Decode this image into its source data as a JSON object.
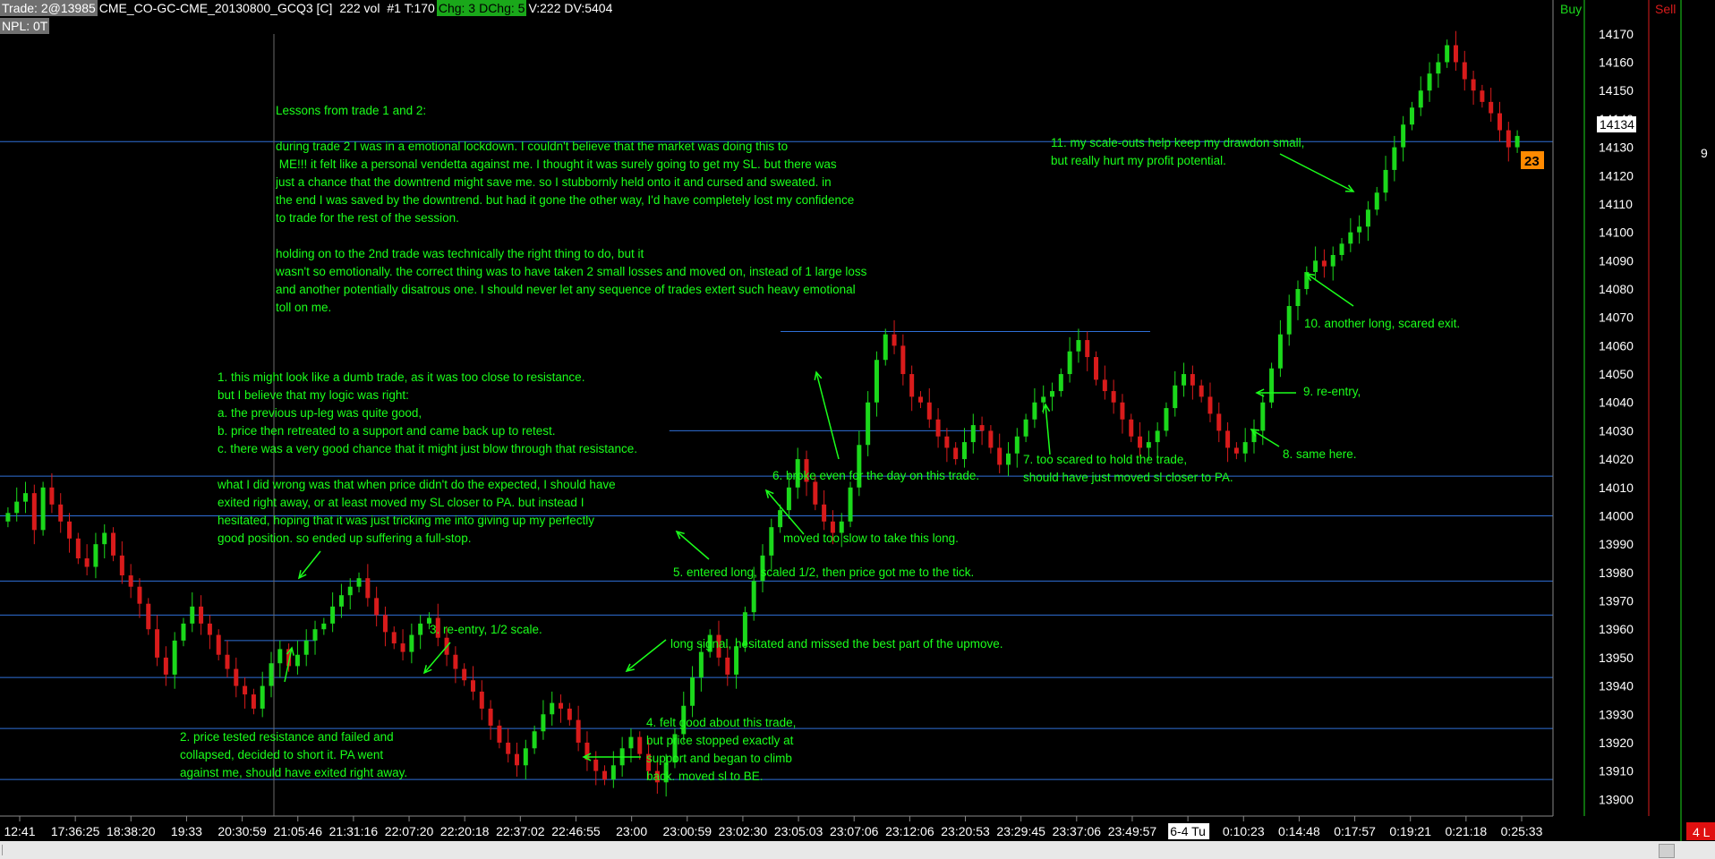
{
  "header": {
    "title": "Trade: 2@13985",
    "instrument": "CME_CO-GC-CME_20130800_GCQ3 [C]",
    "vol": "222 vol",
    "trade_no": "#1 T:170",
    "chg": "Chg: 3",
    "dchg": "DChg: 5",
    "volume": "V:222 DV:5404",
    "npl": "NPL: 0T"
  },
  "colors": {
    "background": "#000000",
    "up_candle": "#1bd81b",
    "down_candle": "#d81b1b",
    "level_line": "#2f6fd8",
    "annotation_text": "#1bff1b",
    "price_label": "#ffffff",
    "last_price_bg": "#ffffff",
    "tag_bg": "#ff8a00"
  },
  "dom": {
    "buy_label": "Buy",
    "sell_label": "Sell",
    "side_count": "9",
    "corner": "4 L"
  },
  "price_axis": {
    "labels": [
      "14170",
      "14160",
      "14150",
      "14140",
      "14130",
      "14120",
      "14110",
      "14100",
      "14090",
      "14080",
      "14070",
      "14060",
      "14050",
      "14040",
      "14030",
      "14020",
      "14010",
      "14000",
      "13990",
      "13980",
      "13970",
      "13960",
      "13950",
      "13940",
      "13930",
      "13920",
      "13910",
      "13900"
    ],
    "last_price": "14134",
    "tag": "23"
  },
  "time_axis": {
    "labels": [
      "12:41",
      "17:36:25",
      "18:38:20",
      "19:33",
      "20:30:59",
      "21:05:46",
      "21:31:16",
      "22:07:20",
      "22:20:18",
      "22:37:02",
      "22:46:55",
      "23:00",
      "23:00:59",
      "23:02:30",
      "23:05:03",
      "23:07:06",
      "23:12:06",
      "23:20:53",
      "23:29:45",
      "23:37:06",
      "23:49:57",
      "6-4 Tu",
      "0:10:23",
      "0:14:48",
      "0:17:57",
      "0:19:21",
      "0:21:18",
      "0:25:33"
    ]
  },
  "chart_data": {
    "type": "candlestick",
    "ylim": [
      13896,
      14175
    ],
    "levels": [
      14132,
      14014,
      14000,
      13977,
      13965,
      13943,
      13925,
      13907
    ],
    "segment_levels": [
      {
        "price": 14065,
        "from": "23:05:03",
        "to": "23:49:57"
      },
      {
        "price": 14030,
        "from": "23:00:59",
        "to": "23:20:53"
      },
      {
        "price": 13956,
        "from": "20:30:59",
        "to": "21:05:46"
      }
    ],
    "closes": [
      14001,
      14005,
      14008,
      13995,
      14010,
      14004,
      13998,
      13992,
      13985,
      13982,
      13990,
      13994,
      13986,
      13979,
      13975,
      13969,
      13960,
      13950,
      13944,
      13956,
      13962,
      13968,
      13962,
      13958,
      13951,
      13946,
      13940,
      13937,
      13932,
      13940,
      13948,
      13953,
      13947,
      13951,
      13956,
      13960,
      13962,
      13968,
      13972,
      13975,
      13978,
      13971,
      13965,
      13959,
      13955,
      13952,
      13958,
      13962,
      13964,
      13957,
      13951,
      13946,
      13942,
      13938,
      13932,
      13926,
      13920,
      13916,
      13912,
      13918,
      13924,
      13930,
      13934,
      13932,
      13928,
      13920,
      13914,
      13910,
      13907,
      13912,
      13918,
      13922,
      13916,
      13910,
      13906,
      13913,
      13923,
      13933,
      13943,
      13952,
      13958,
      13950,
      13944,
      13954,
      13966,
      13977,
      13986,
      13996,
      14002,
      14010,
      14020,
      14012,
      14004,
      13998,
      13994,
      13998,
      14010,
      14025,
      14040,
      14055,
      14064,
      14060,
      14050,
      14042,
      14040,
      14034,
      14028,
      14024,
      14020,
      14026,
      14032,
      14030,
      14024,
      14018,
      14022,
      14028,
      14034,
      14040,
      14042,
      14044,
      14050,
      14058,
      14062,
      14056,
      14048,
      14044,
      14040,
      14034,
      14028,
      14024,
      14026,
      14030,
      14038,
      14046,
      14050,
      14046,
      14042,
      14036,
      14030,
      14024,
      14022,
      14026,
      14030,
      14040,
      14052,
      14064,
      14074,
      14080,
      14086,
      14090,
      14088,
      14092,
      14096,
      14100,
      14102,
      14108,
      14114,
      14122,
      14130,
      14138,
      14144,
      14150,
      14156,
      14160,
      14166,
      14160,
      14154,
      14150,
      14146,
      14142,
      14136,
      14130,
      14134
    ]
  },
  "annotations": {
    "lessons": "Lessons from trade 1 and 2:\n\nduring trade 2 I was in a emotional lockdown. I couldn't believe that the market was doing this to\n ME!!! it felt like a personal vendetta against me. I thought it was surely going to get my SL. but there was\njust a chance that the downtrend might save me. so I stubbornly held onto it and cursed and sweated. in\nthe end I was saved by the downtrend. but had it gone the other way, I'd have completely lost my confidence\nto trade for the rest of the session.\n\nholding on to the 2nd trade was technically the right thing to do, but it\nwasn't so emotionally. the correct thing was to have taken 2 small losses and moved on, instead of 1 large loss\nand another potentially disatrous one. I should never let any sequence of trades extert such heavy emotional\ntoll on me.",
    "note1": "1. this might look like a dumb trade, as it was too close to resistance.\nbut I believe that my logic was right:\na. the previous up-leg was quite good,\nb. price then retreated to a support and came back up to retest.\nc. there was a very good chance that it might just blow through that resistance.",
    "note1b": "what I did wrong was that when price didn't do the expected, I should have\nexited right away, or at least moved my SL closer to PA. but instead I\nhesitated, hoping that it was just tricking me into giving up my perfectly\ngood position. so ended up suffering a full-stop.",
    "note2": "2. price tested resistance and failed and\ncollapsed, decided to short it. PA went\nagainst me, should have exited right away.",
    "note3": "3. re-entry, 1/2 scale.",
    "note4": "4. felt good about this trade,\nbut price stopped exactly at\nsupport and began to climb\nback. moved sl to BE.",
    "note_long": "long signal, hesitated and missed the best part of the upmove.",
    "note5": "5. entered long, scaled 1/2, then price got me to the tick.",
    "note_slow": "moved too slow to take this long.",
    "note6": "6. broke even for the day on this trade.",
    "note7": "7. too scared to hold the trade,\nshould have just moved sl closer to PA.",
    "note8": "8. same here.",
    "note9": "9. re-entry,",
    "note10": "10. another long, scared exit.",
    "note11": "11. my scale-outs help keep my drawdon small,\nbut really hurt my profit potential."
  }
}
